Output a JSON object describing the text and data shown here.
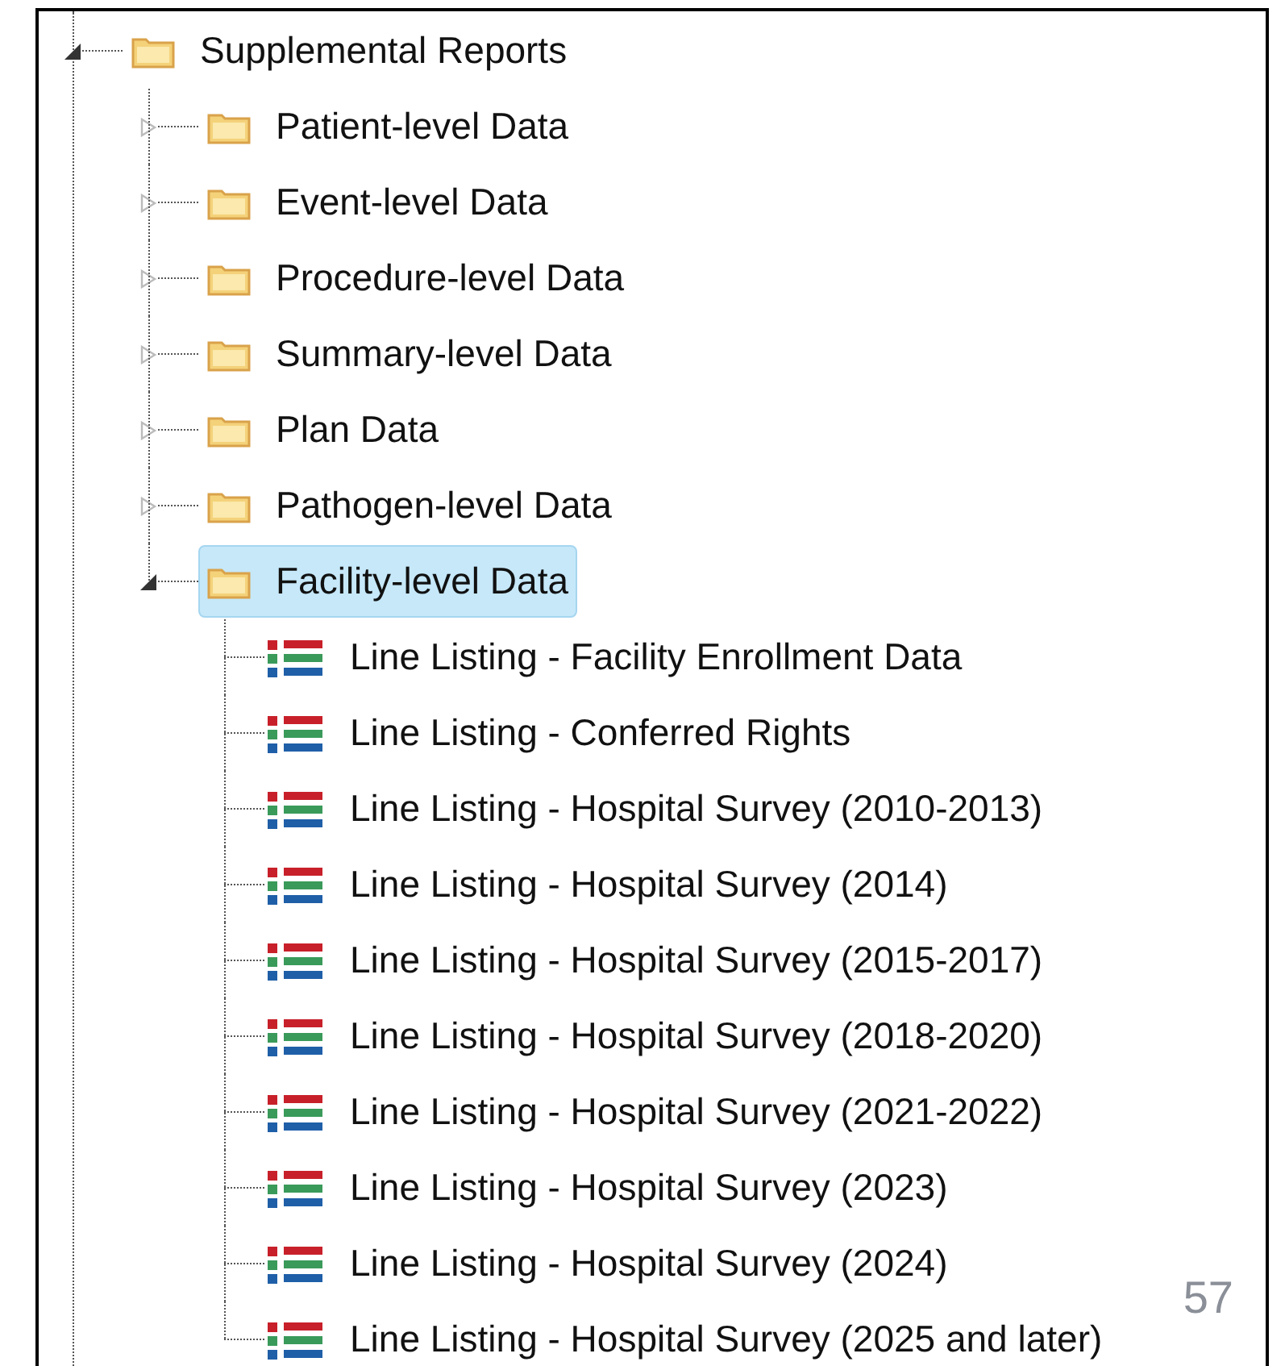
{
  "tree": [
    {
      "kind": "folder",
      "label": "Supplemental Reports",
      "expanded": true,
      "selected": false,
      "children": [
        {
          "kind": "folder",
          "label": "Patient-level Data",
          "expanded": false,
          "selected": false
        },
        {
          "kind": "folder",
          "label": "Event-level Data",
          "expanded": false,
          "selected": false
        },
        {
          "kind": "folder",
          "label": "Procedure-level Data",
          "expanded": false,
          "selected": false
        },
        {
          "kind": "folder",
          "label": "Summary-level Data",
          "expanded": false,
          "selected": false
        },
        {
          "kind": "folder",
          "label": "Plan Data",
          "expanded": false,
          "selected": false
        },
        {
          "kind": "folder",
          "label": "Pathogen-level Data",
          "expanded": false,
          "selected": false
        },
        {
          "kind": "folder",
          "label": "Facility-level Data",
          "expanded": true,
          "selected": true,
          "children": [
            {
              "kind": "report",
              "label": "Line Listing - Facility Enrollment Data",
              "selected": false
            },
            {
              "kind": "report",
              "label": "Line Listing - Conferred Rights",
              "selected": false
            },
            {
              "kind": "report",
              "label": "Line Listing - Hospital Survey (2010-2013)",
              "selected": false
            },
            {
              "kind": "report",
              "label": "Line Listing - Hospital Survey (2014)",
              "selected": false
            },
            {
              "kind": "report",
              "label": "Line Listing - Hospital Survey (2015-2017)",
              "selected": false
            },
            {
              "kind": "report",
              "label": "Line Listing - Hospital Survey (2018-2020)",
              "selected": false
            },
            {
              "kind": "report",
              "label": "Line Listing - Hospital Survey (2021-2022)",
              "selected": false
            },
            {
              "kind": "report",
              "label": "Line Listing - Hospital Survey (2023)",
              "selected": false
            },
            {
              "kind": "report",
              "label": "Line Listing - Hospital Survey (2024)",
              "selected": false
            },
            {
              "kind": "report",
              "label": "Line Listing - Hospital Survey (2025 and later)",
              "selected": false
            }
          ]
        }
      ]
    }
  ],
  "page_number": "57"
}
